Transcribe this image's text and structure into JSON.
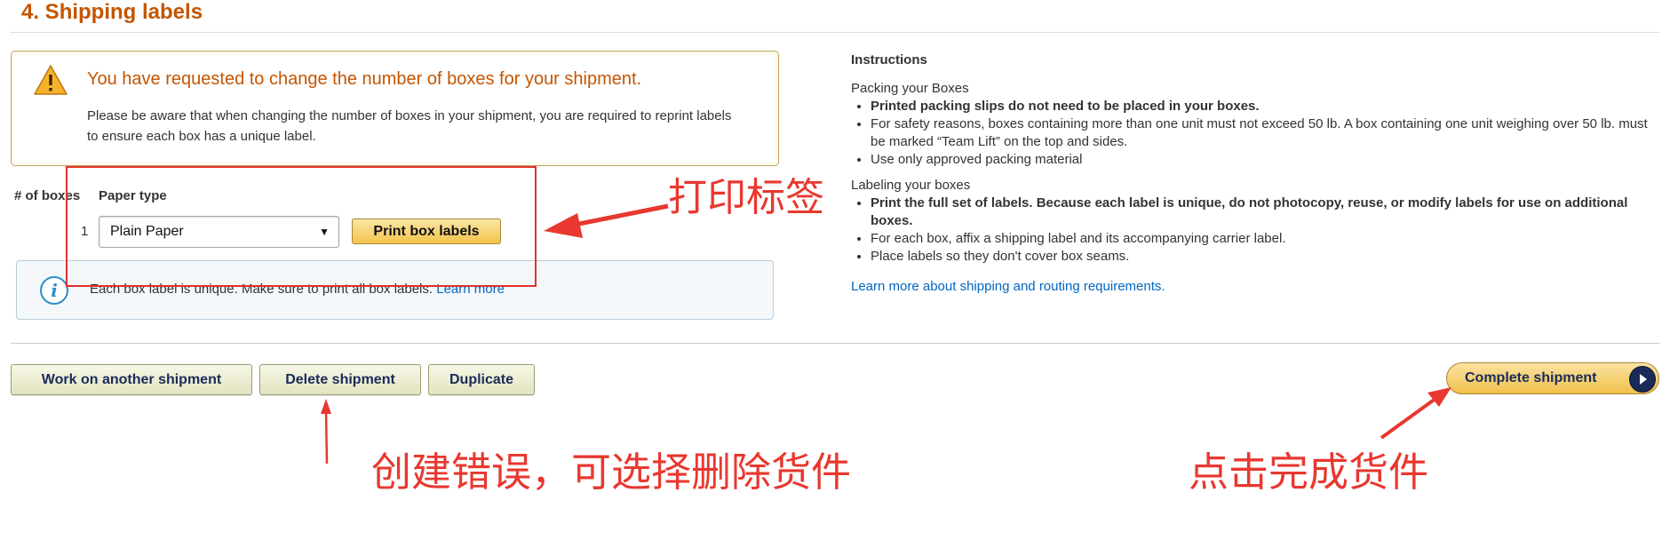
{
  "section": {
    "title": "4. Shipping labels"
  },
  "alert": {
    "heading": "You have requested to change the number of boxes for your shipment.",
    "body": "Please be aware that when changing the number of boxes in your shipment, you are required to reprint labels to ensure each box has a unique label.",
    "icon": "warning-icon"
  },
  "boxes": {
    "count_label": "# of boxes",
    "paper_label": "Paper type",
    "rows": [
      {
        "index": "1",
        "paper_type": "Plain Paper"
      }
    ],
    "print_button": "Print box labels"
  },
  "info": {
    "text": "Each box label is unique. Make sure to print all box labels.",
    "link": "Learn more",
    "icon": "info-icon"
  },
  "instructions": {
    "title": "Instructions",
    "packing_heading": "Packing your Boxes",
    "packing_items": [
      "Printed packing slips do not need to be placed in your boxes.",
      "For safety reasons, boxes containing more than one unit must not exceed 50 lb. A box containing one unit weighing over 50 lb. must be marked “Team Lift” on the top and sides.",
      "Use only approved packing material"
    ],
    "labeling_heading": "Labeling your boxes",
    "labeling_items": [
      "Print the full set of labels. Because each label is unique, do not photocopy, reuse, or modify labels for use on additional boxes.",
      "For each box, affix a shipping label and its accompanying carrier label.",
      "Place labels so they don't cover box seams."
    ],
    "link": "Learn more about shipping and routing requirements."
  },
  "actions": {
    "work_another": "Work on another shipment",
    "delete": "Delete shipment",
    "duplicate": "Duplicate",
    "complete": "Complete shipment"
  },
  "annotations": {
    "print_note": "打印标签",
    "delete_note": "创建错误，可选择删除货件",
    "complete_note": "点击完成货件",
    "color": "#e8382f"
  }
}
